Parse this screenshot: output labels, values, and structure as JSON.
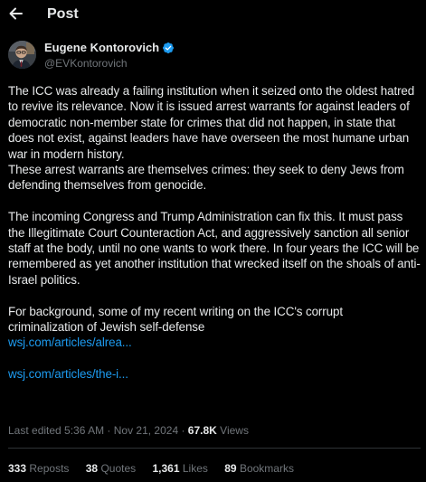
{
  "header": {
    "back_icon": "arrow-left-icon",
    "title": "Post"
  },
  "author": {
    "name": "Eugene Kontorovich",
    "handle": "@EVKontorovich",
    "verified_icon": "verified-badge-icon",
    "verified_color": "#1d9bf0"
  },
  "post": {
    "paragraphs": [
      "The ICC was already a failing institution when it seized onto the oldest hatred to revive its relevance. Now it is issued arrest warrants for against leaders of democratic non-member state for crimes that did not happen, in state that does not exist, against leaders have have overseen the most humane urban war in modern history.",
      "These arrest warrants are themselves crimes: they seek to deny  Jews from defending themselves from genocide.",
      "The incoming Congress and Trump Administration can fix this. It must pass the Illegitimate Court Counteraction Act, and aggressively sanction all senior staff at the body, until no one wants to work there. In four years the ICC will be remembered as yet another institution that wrecked itself on the shoals of anti-Israel politics.",
      "For background, some of my recent writing on the ICC's corrupt criminalization of Jewish self-defense"
    ],
    "links": [
      "wsj.com/articles/alrea...",
      "wsj.com/articles/the-i..."
    ]
  },
  "meta": {
    "edited": "Last edited 5:36 AM · Nov 21, 2024 ·",
    "views_count": "67.8K",
    "views_label": "Views"
  },
  "stats": {
    "reposts_count": "333",
    "reposts_label": "Reposts",
    "quotes_count": "38",
    "quotes_label": "Quotes",
    "likes_count": "1,361",
    "likes_label": "Likes",
    "bookmarks_count": "89",
    "bookmarks_label": "Bookmarks"
  },
  "colors": {
    "background": "#000000",
    "text": "#e7e9ea",
    "secondary": "#71767b",
    "link": "#1d9bf0",
    "divider": "#2f3336"
  }
}
